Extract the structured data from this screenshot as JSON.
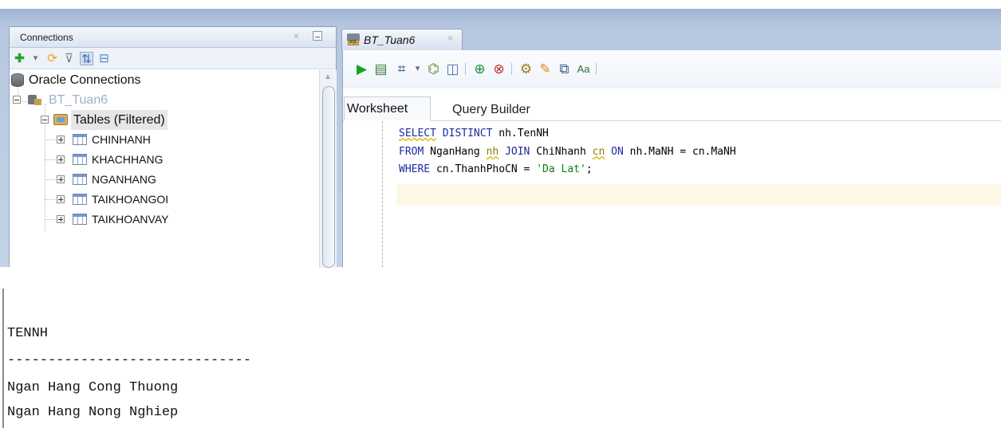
{
  "connections_panel": {
    "title": "Connections",
    "close_symbol": "×",
    "tree": {
      "root_label": "Oracle Connections",
      "connection_label": "BT_Tuan6",
      "tables_label": "Tables (Filtered)",
      "tables": [
        "CHINHANH",
        "KHACHHANG",
        "NGANHANG",
        "TAIKHOANGOI",
        "TAIKHOANVAY"
      ]
    }
  },
  "editor": {
    "tab_title": "BT_Tuan6",
    "tab_close_symbol": "×",
    "sheet_tabs": {
      "active": "Worksheet",
      "other": "Query Builder"
    },
    "sql_lines": [
      "SELECT DISTINCT nh.TenNH",
      "FROM NganHang nh JOIN ChiNhanh cn ON nh.MaNH = cn.MaNH",
      "WHERE cn.ThanhPhoCN = 'Da Lat';"
    ]
  },
  "results": {
    "header": "TENNH",
    "separator": "------------------------------",
    "rows": [
      "Ngan Hang Cong Thuong",
      "Ngan Hang Nong Nghiep"
    ]
  },
  "icons": {
    "connections_toolbar": [
      "add-connection-icon",
      "dropdown-icon",
      "refresh-icon",
      "filter-icon",
      "schema-browser-icon",
      "collapse-icon"
    ],
    "editor_toolbar": [
      "run-statement-icon",
      "run-script-icon",
      "commit-icon",
      "rollback-icon",
      "autotrace-icon",
      "explain-plan-icon",
      "sql-tuning-icon",
      "eraser-icon",
      "history-icon",
      "format-icon"
    ]
  }
}
